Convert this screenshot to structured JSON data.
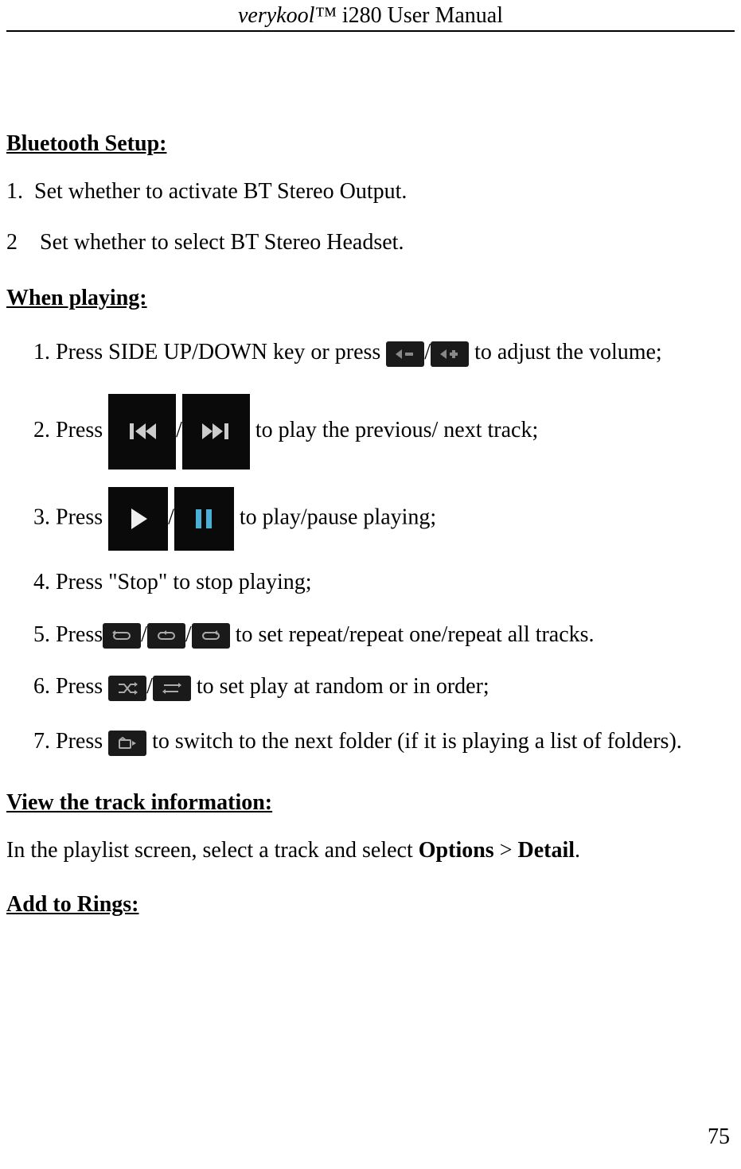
{
  "header": {
    "title_italic": "verykool™",
    "title_normal": " i280 User Manual"
  },
  "sections": {
    "bluetooth_heading": "Bluetooth Setup:",
    "bluetooth_items": {
      "i1_num": "1.",
      "i1_text": "Set whether to activate BT Stereo Output.",
      "i2_num": "2",
      "i2_text": "Set whether to select BT Stereo Headset."
    },
    "when_playing_heading": "When playing:",
    "wp": {
      "i1_a": "1. Press SIDE UP/DOWN key or press ",
      "i1_slash": "/",
      "i1_b": " to adjust the volume;",
      "i2_a": "2. Press  ",
      "i2_slash": "/",
      "i2_b": "  to play the previous/ next track;",
      "i3_a": "3. Press ",
      "i3_slash": "/",
      "i3_b": " to play/pause playing;",
      "i4": "4. Press \"Stop\" to stop playing;",
      "i5_a": "5. Press",
      "i5_s1": "/",
      "i5_s2": "/",
      "i5_b": " to set repeat/repeat one/repeat all tracks.",
      "i6_a": "6. Press ",
      "i6_s": "/",
      "i6_b": " to set play at random or in order;",
      "i7_a": "7. Press ",
      "i7_b": " to switch to the next folder (if it is playing a list of folders)."
    },
    "view_heading": "View the track information:  ",
    "view_text_a": "In the playlist screen, select a track and select ",
    "view_options": "Options",
    "view_gt": " > ",
    "view_detail": "Detail",
    "view_period": ".",
    "add_rings_heading": "Add to Rings:"
  },
  "page_number": "75"
}
